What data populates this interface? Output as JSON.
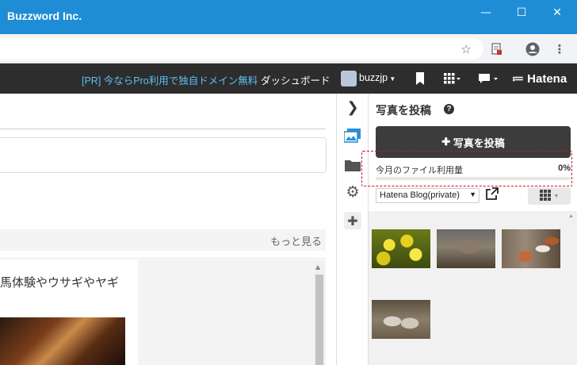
{
  "window": {
    "title": "Buzzword Inc.",
    "controls": [
      "minimize-icon",
      "maximize-icon",
      "close-icon"
    ]
  },
  "toolbar": {
    "icons": [
      "star-icon",
      "page-edit-icon",
      "account-icon",
      "menu-dots-icon"
    ]
  },
  "hatena_nav": {
    "promo_link": "[PR] 今ならPro利用で独自ドメイン無料",
    "dashboard_link": "ダッシュボード",
    "username": "buzzjp",
    "logo_text": "Hatena",
    "colors": {
      "bar_bg": "#2d2d2d",
      "promo": "#5bc0f0"
    }
  },
  "editor": {
    "more_link": "もっと見る",
    "entry_title": "馬体験やウサギやヤギ"
  },
  "sidebar_icons": [
    "chevron-right-icon",
    "photo-icon",
    "folder-icon",
    "gear-icon",
    "plus-icon"
  ],
  "photo_panel": {
    "title": "写真を投稿",
    "post_button_label": "写真を投稿",
    "usage_label": "今月のファイル利用量",
    "usage_percent": "0%",
    "usage_fraction": 0,
    "album_select": "Hatena Blog(private)",
    "highlight_color": "#c4161c",
    "photos": [
      {
        "name": "rapeseed-flowers-photo"
      },
      {
        "name": "animals-in-pen-photo"
      },
      {
        "name": "guinea-pigs-photo"
      },
      {
        "name": "sheep-photo"
      }
    ]
  }
}
